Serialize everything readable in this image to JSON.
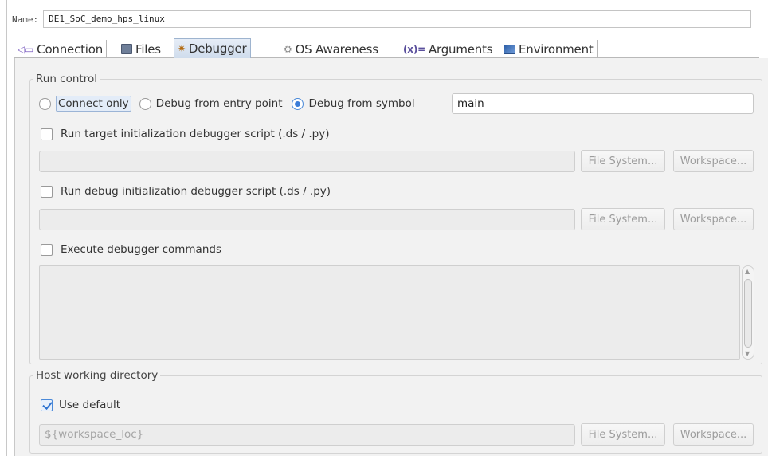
{
  "name_row": {
    "label": "Name:",
    "value": "DE1_SoC_demo_hps_linux"
  },
  "tabs": [
    {
      "label": "Connection",
      "icon": "connection-icon"
    },
    {
      "label": "Files",
      "icon": "files-icon"
    },
    {
      "label": "Debugger",
      "icon": "debugger-icon",
      "active": true
    },
    {
      "label": "OS Awareness",
      "icon": "os-awareness-icon"
    },
    {
      "label": "Arguments",
      "icon": "arguments-icon"
    },
    {
      "label": "Environment",
      "icon": "environment-icon"
    }
  ],
  "run_control": {
    "title": "Run control",
    "radio_connect_only": "Connect only",
    "radio_entry_point": "Debug from entry point",
    "radio_symbol": "Debug from symbol",
    "selected": "Debug from symbol",
    "symbol_value": "main",
    "target_init": {
      "label": "Run target initialization debugger script (.ds / .py)",
      "checked": false,
      "path": ""
    },
    "debug_init": {
      "label": "Run debug initialization debugger script (.ds / .py)",
      "checked": false,
      "path": ""
    },
    "execute": {
      "label": "Execute debugger commands",
      "checked": false,
      "commands": ""
    },
    "file_system_label": "File System...",
    "workspace_label": "Workspace..."
  },
  "host_dir": {
    "title": "Host working directory",
    "use_default_label": "Use default",
    "use_default_checked": true,
    "path": "${workspace_loc}",
    "file_system_label": "File System...",
    "workspace_label": "Workspace..."
  },
  "colors": {
    "active_tab": "#d6e1ef",
    "accent": "#3b7dd8",
    "panel_bg": "#f2f2f2"
  }
}
